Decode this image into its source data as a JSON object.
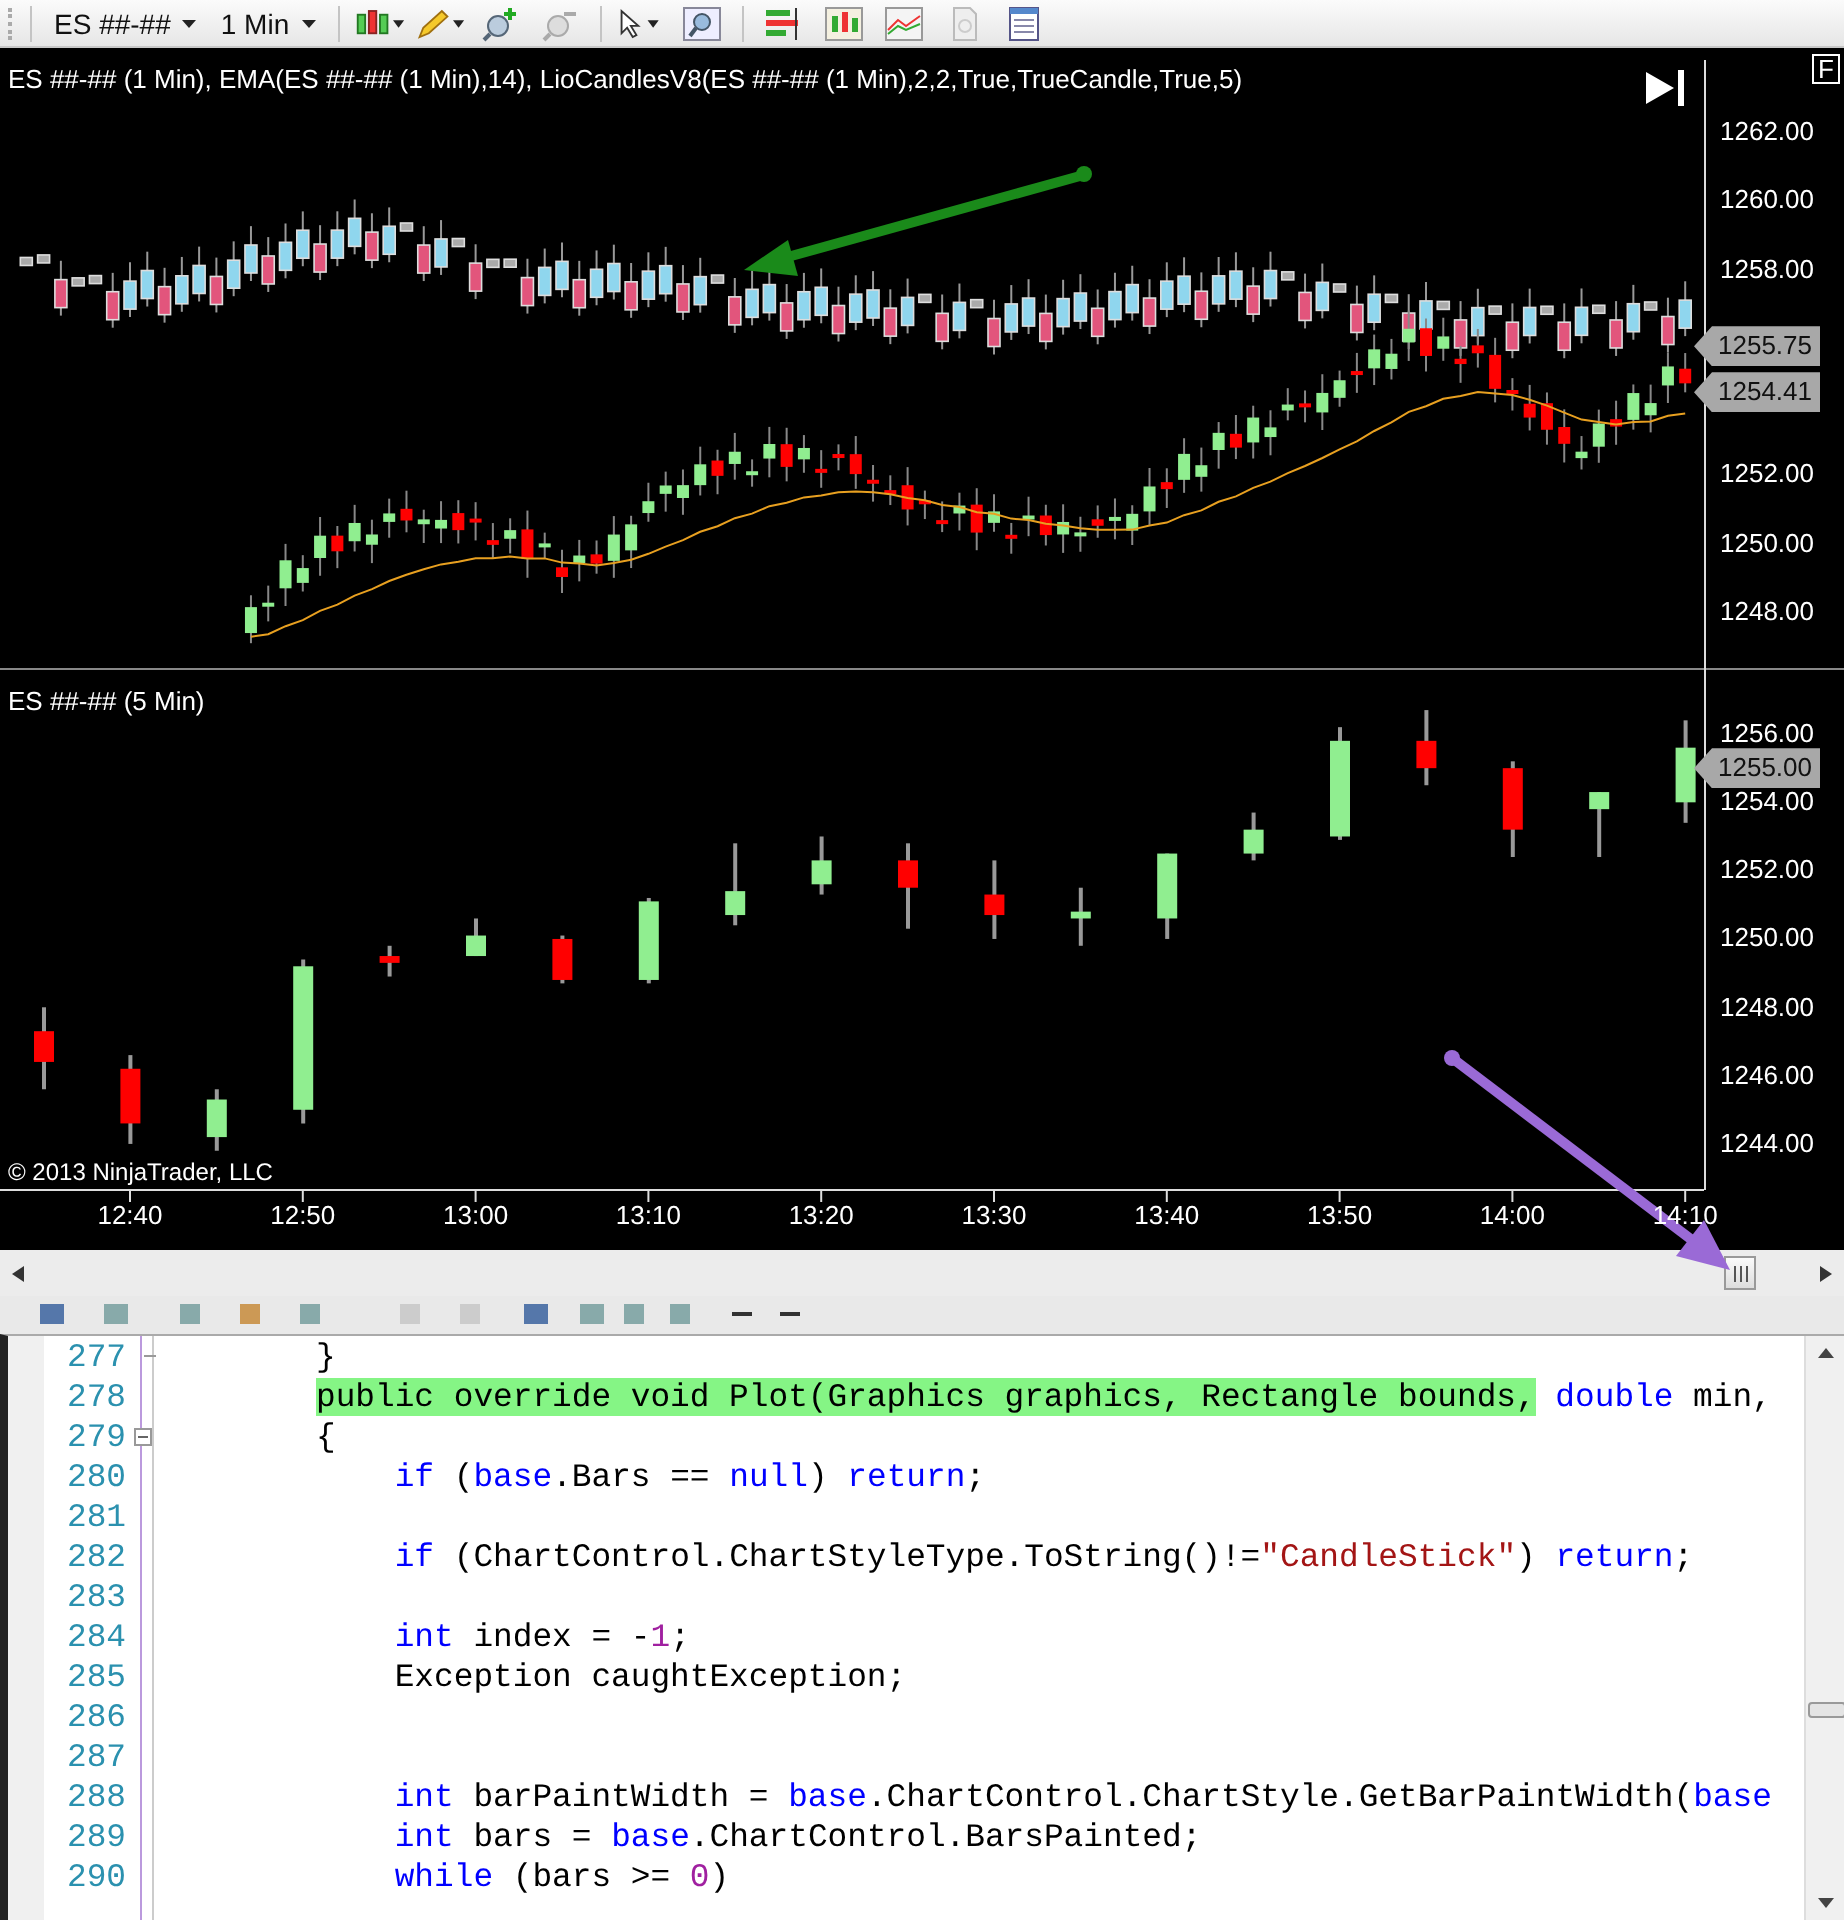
{
  "toolbar": {
    "instrument": "ES ##-##",
    "interval": "1 Min"
  },
  "upper_chart": {
    "legend": "ES ##-## (1 Min), EMA(ES ##-## (1 Min),14), LioCandlesV8(ES ##-## (1 Min),2,2,True,TrueCandle,True,5)",
    "corner_button": "F",
    "price_ticks": [
      "1262.00",
      "1260.00",
      "1258.00",
      "1252.00",
      "1250.00",
      "1248.00"
    ],
    "price_markers": [
      "1255.75",
      "1254.41"
    ]
  },
  "lower_chart": {
    "legend": "ES ##-## (5 Min)",
    "copyright": "© 2013 NinjaTrader, LLC",
    "price_ticks": [
      "1256.00",
      "1254.00",
      "1252.00",
      "1250.00",
      "1248.00",
      "1246.00",
      "1244.00"
    ],
    "price_markers": [
      "1255.00"
    ],
    "time_ticks": [
      "12:40",
      "12:50",
      "13:00",
      "13:10",
      "13:20",
      "13:30",
      "13:40",
      "13:50",
      "14:00",
      "14:10"
    ]
  },
  "code_editor": {
    "lines": [
      {
        "number": "277",
        "block_end": true,
        "segments": [
          {
            "text": "}",
            "kind": "plain"
          }
        ]
      },
      {
        "number": "278",
        "segments": [
          {
            "text": "public override void Plot(Graphics graphics, Rectangle bounds,",
            "kind": "highlight"
          },
          {
            "text": " double",
            "kind": "keyword"
          },
          {
            "text": " min,",
            "kind": "plain"
          }
        ]
      },
      {
        "number": "279",
        "expanded": true,
        "segments": [
          {
            "text": "{",
            "kind": "plain"
          }
        ],
        "children": [
          {
            "number": "280",
            "segments": [
              {
                "text": "if",
                "kind": "keyword"
              },
              {
                "text": " (",
                "kind": "plain"
              },
              {
                "text": "base",
                "kind": "keyword"
              },
              {
                "text": ".Bars == ",
                "kind": "plain"
              },
              {
                "text": "null",
                "kind": "keyword"
              },
              {
                "text": ") ",
                "kind": "plain"
              },
              {
                "text": "return",
                "kind": "keyword"
              },
              {
                "text": ";",
                "kind": "plain"
              }
            ]
          },
          {
            "number": "281"
          },
          {
            "number": "282",
            "segments": [
              {
                "text": "if",
                "kind": "keyword"
              },
              {
                "text": " (ChartControl.ChartStyleType.ToString()!=",
                "kind": "plain"
              },
              {
                "text": "\"CandleStick\"",
                "kind": "string"
              },
              {
                "text": ") ",
                "kind": "plain"
              },
              {
                "text": "return",
                "kind": "keyword"
              },
              {
                "text": ";",
                "kind": "plain"
              }
            ]
          },
          {
            "number": "283"
          },
          {
            "number": "284",
            "segments": [
              {
                "text": "int",
                "kind": "keyword"
              },
              {
                "text": " index = -",
                "kind": "plain"
              },
              {
                "text": "1",
                "kind": "number"
              },
              {
                "text": ";",
                "kind": "plain"
              }
            ]
          },
          {
            "number": "285",
            "segments": [
              {
                "text": "Exception caughtException;",
                "kind": "plain"
              }
            ]
          },
          {
            "number": "286"
          },
          {
            "number": "287"
          },
          {
            "number": "288",
            "segments": [
              {
                "text": "int",
                "kind": "keyword"
              },
              {
                "text": " barPaintWidth = ",
                "kind": "plain"
              },
              {
                "text": "base",
                "kind": "keyword"
              },
              {
                "text": ".ChartControl.ChartStyle.GetBarPaintWidth(",
                "kind": "plain"
              },
              {
                "text": "base",
                "kind": "keyword"
              }
            ]
          },
          {
            "number": "289",
            "segments": [
              {
                "text": "int",
                "kind": "keyword"
              },
              {
                "text": " bars = ",
                "kind": "plain"
              },
              {
                "text": "base",
                "kind": "keyword"
              },
              {
                "text": ".ChartControl.BarsPainted;",
                "kind": "plain"
              }
            ]
          },
          {
            "number": "290",
            "segments": [
              {
                "text": "while",
                "kind": "keyword"
              },
              {
                "text": " (bars >= ",
                "kind": "plain"
              },
              {
                "text": "0",
                "kind": "number"
              },
              {
                "text": ")",
                "kind": "plain"
              }
            ]
          }
        ]
      }
    ]
  }
}
